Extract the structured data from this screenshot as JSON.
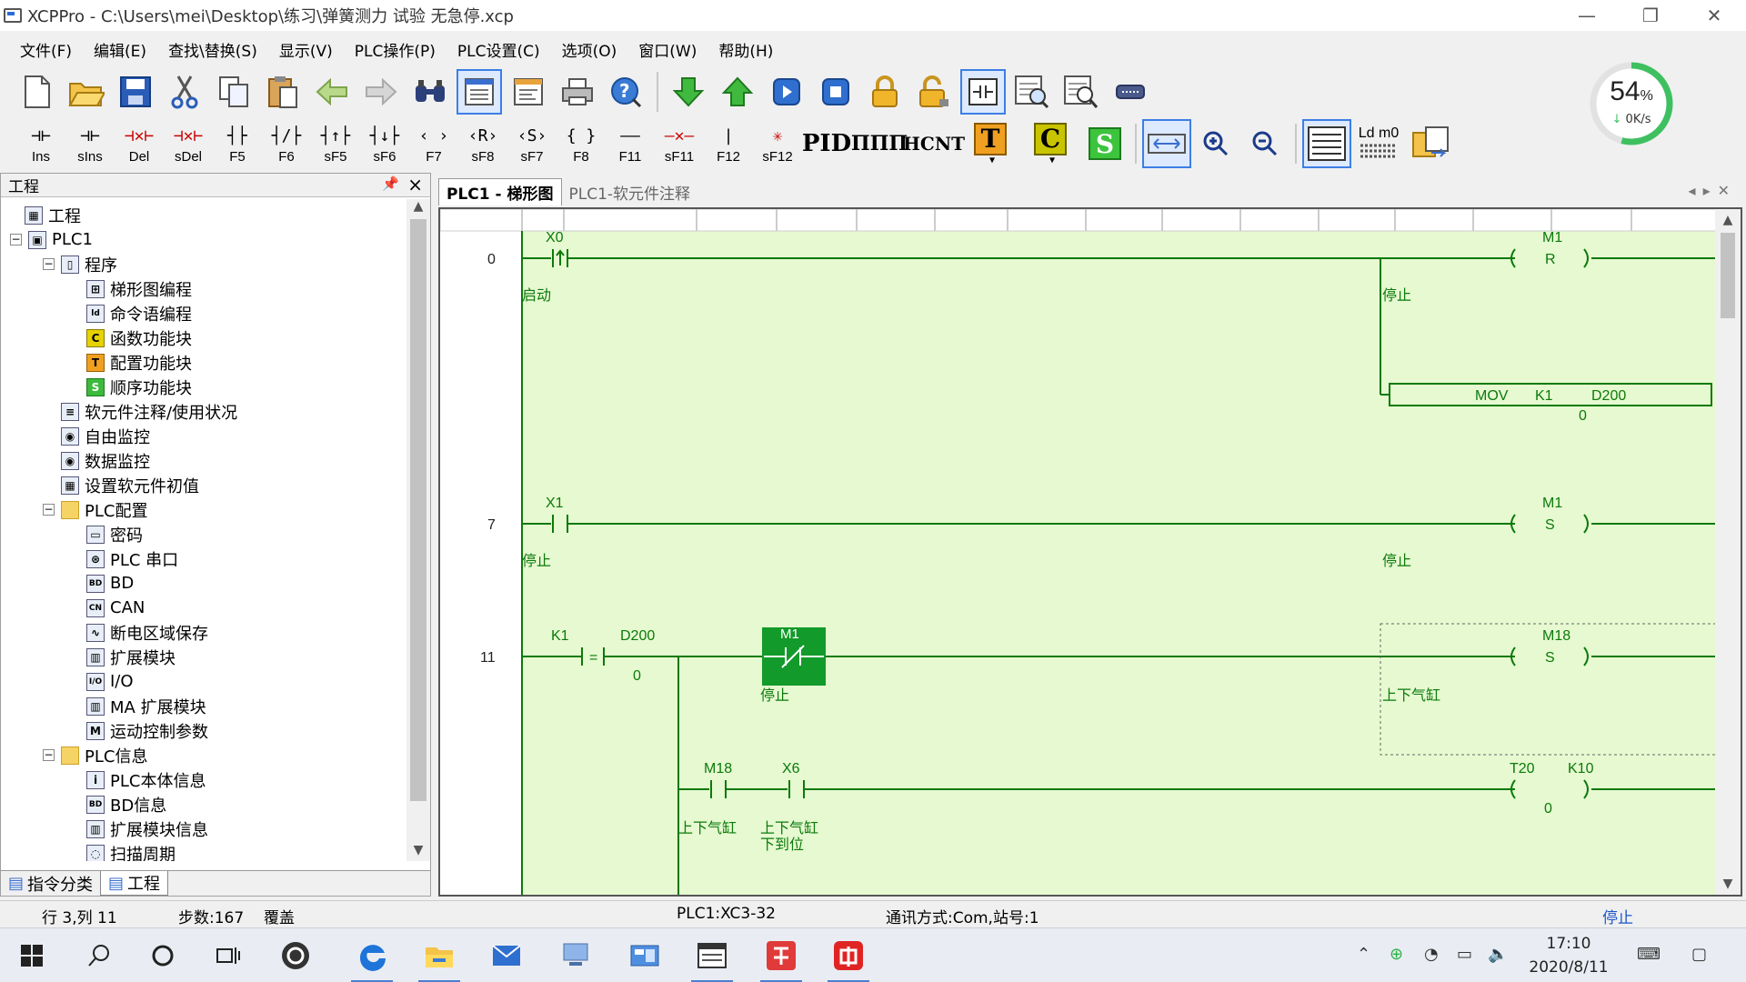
{
  "window": {
    "title": "XCPPro - C:\\Users\\mei\\Desktop\\练习\\弹簧测力 试验 无急停.xcp",
    "controls": [
      "minimize",
      "restore",
      "close"
    ]
  },
  "menu": [
    "文件(F)",
    "编辑(E)",
    "查找\\替换(S)",
    "显示(V)",
    "PLC操作(P)",
    "PLC设置(C)",
    "选项(O)",
    "窗口(W)",
    "帮助(H)"
  ],
  "toolbar_main": [
    {
      "name": "new-icon"
    },
    {
      "name": "open-icon"
    },
    {
      "name": "save-icon"
    },
    {
      "name": "cut-icon"
    },
    {
      "name": "copy-icon"
    },
    {
      "name": "paste-icon"
    },
    {
      "name": "back-icon"
    },
    {
      "name": "forward-icon"
    },
    {
      "name": "find-icon"
    },
    {
      "name": "ladder-view-icon",
      "active": true
    },
    {
      "name": "instruction-view-icon"
    },
    {
      "name": "print-icon"
    },
    {
      "name": "help-icon"
    },
    {
      "name": "download-icon"
    },
    {
      "name": "upload-icon"
    },
    {
      "name": "run-icon"
    },
    {
      "name": "stop-icon"
    },
    {
      "name": "lock-icon"
    },
    {
      "name": "unlock-icon"
    },
    {
      "name": "monitor-ladder-icon",
      "active": true
    },
    {
      "name": "free-monitor-icon"
    },
    {
      "name": "data-monitor-icon"
    },
    {
      "name": "comm-icon"
    }
  ],
  "toolbar_ladder": [
    {
      "sym": "⊣⊢",
      "cap": "Ins"
    },
    {
      "sym": "⊣⊢",
      "cap": "sIns"
    },
    {
      "sym": "⊣✕⊢",
      "cap": "Del"
    },
    {
      "sym": "⊣✕⊢",
      "cap": "sDel"
    },
    {
      "sym": "┤├",
      "cap": "F5"
    },
    {
      "sym": "┤/├",
      "cap": "F6"
    },
    {
      "sym": "┤↑├",
      "cap": "sF5"
    },
    {
      "sym": "┤↓├",
      "cap": "sF6"
    },
    {
      "sym": "‹ ›",
      "cap": "F7"
    },
    {
      "sym": "‹R›",
      "cap": "sF8"
    },
    {
      "sym": "‹S›",
      "cap": "sF7"
    },
    {
      "sym": "{ }",
      "cap": "F8"
    },
    {
      "sym": "——",
      "cap": "F11"
    },
    {
      "sym": "—✕—",
      "cap": "sF11"
    },
    {
      "sym": "|",
      "cap": "F12"
    },
    {
      "sym": "✳",
      "cap": "sF12"
    }
  ],
  "toolbar_blocks": [
    "PID",
    "ΠΠΠ",
    "HCNT",
    "T",
    "C",
    "S"
  ],
  "toolbar_misc": {
    "ld_label": "Ld m0"
  },
  "gauge": {
    "percent": 54,
    "percent_text": "54",
    "unit": "%",
    "speed": "0K/s"
  },
  "left_panel": {
    "title": "工程",
    "tree": [
      {
        "label": "工程",
        "depth": 0,
        "icon": "project"
      },
      {
        "label": "PLC1",
        "depth": 1,
        "icon": "plc"
      },
      {
        "label": "程序",
        "depth": 2,
        "icon": "doc"
      },
      {
        "label": "梯形图编程",
        "depth": 3,
        "icon": "ladder"
      },
      {
        "label": "命令语编程",
        "depth": 3,
        "icon": "ld"
      },
      {
        "label": "函数功能块",
        "depth": 3,
        "icon": "c"
      },
      {
        "label": "配置功能块",
        "depth": 3,
        "icon": "t"
      },
      {
        "label": "顺序功能块",
        "depth": 3,
        "icon": "s"
      },
      {
        "label": "软元件注释/使用状况",
        "depth": 2,
        "icon": "list"
      },
      {
        "label": "自由监控",
        "depth": 2,
        "icon": "monitor"
      },
      {
        "label": "数据监控",
        "depth": 2,
        "icon": "monitor"
      },
      {
        "label": "设置软元件初值",
        "depth": 2,
        "icon": "grid"
      },
      {
        "label": "PLC配置",
        "depth": 2,
        "icon": "folder"
      },
      {
        "label": "密码",
        "depth": 3,
        "icon": "key"
      },
      {
        "label": "PLC 串口",
        "depth": 3,
        "icon": "port"
      },
      {
        "label": "BD",
        "depth": 3,
        "icon": "bd"
      },
      {
        "label": "CAN",
        "depth": 3,
        "icon": "can"
      },
      {
        "label": "断电区域保存",
        "depth": 3,
        "icon": "wave"
      },
      {
        "label": "扩展模块",
        "depth": 3,
        "icon": "ext"
      },
      {
        "label": "I/O",
        "depth": 3,
        "icon": "io"
      },
      {
        "label": "MA 扩展模块",
        "depth": 3,
        "icon": "ext"
      },
      {
        "label": "运动控制参数",
        "depth": 3,
        "icon": "m"
      },
      {
        "label": "PLC信息",
        "depth": 2,
        "icon": "folder"
      },
      {
        "label": "PLC本体信息",
        "depth": 3,
        "icon": "info"
      },
      {
        "label": "BD信息",
        "depth": 3,
        "icon": "bd"
      },
      {
        "label": "扩展模块信息",
        "depth": 3,
        "icon": "ext"
      },
      {
        "label": "扫描周期",
        "depth": 3,
        "icon": "clock"
      }
    ],
    "bottom_tabs": [
      {
        "label": "指令分类",
        "active": false
      },
      {
        "label": "工程",
        "active": true
      }
    ]
  },
  "editor": {
    "tabs": [
      {
        "label": "PLC1 - 梯形图",
        "active": true
      },
      {
        "label": "PLC1-软元件注释",
        "active": false
      }
    ],
    "rungs": [
      {
        "step": "0",
        "contacts": [
          {
            "addr": "X0",
            "type": "rising",
            "comment": "启动"
          }
        ],
        "coils": [
          {
            "addr": "M1",
            "op": "R",
            "comment": "停止"
          }
        ],
        "instruction": {
          "mnemonic": "MOV",
          "src": "K1",
          "dst": "D200",
          "value": "0"
        }
      },
      {
        "step": "7",
        "contacts": [
          {
            "addr": "X1",
            "type": "no",
            "comment": "停止"
          }
        ],
        "coils": [
          {
            "addr": "M1",
            "op": "S",
            "comment": "停止"
          }
        ]
      },
      {
        "step": "11",
        "compare": {
          "left": "K1",
          "op": "=",
          "right": "D200",
          "value": "0"
        },
        "contacts": [
          {
            "addr": "M1",
            "type": "nc",
            "comment": "停止",
            "energized": true
          }
        ],
        "coils": [
          {
            "addr": "M18",
            "op": "S",
            "comment": "上下气缸"
          }
        ],
        "branch": {
          "contacts": [
            {
              "addr": "M18",
              "type": "no",
              "comment": "上下气缸"
            },
            {
              "addr": "X6",
              "type": "no",
              "comment": "上下气缸",
              "comment2": "下到位"
            }
          ],
          "timer": {
            "addr": "T20",
            "preset": "K10",
            "value": "0"
          }
        }
      }
    ]
  },
  "status_bar": {
    "position": "行 3,列 11",
    "steps": "步数:167",
    "mode": "覆盖",
    "plc_model": "PLC1:XC3-32",
    "comm": "通讯方式:Com,站号:1",
    "plc_state": "停止"
  },
  "taskbar": {
    "icons": [
      "windows-start-icon",
      "search-icon",
      "cortana-icon",
      "task-view-icon",
      "app-icon",
      "edge-icon",
      "file-explorer-icon",
      "mail-icon",
      "network-app-icon",
      "control-panel-icon",
      "xcppro-icon",
      "wps-icon",
      "app-red-icon"
    ],
    "time": "17:10",
    "date": "2020/8/11"
  },
  "colors": {
    "ladder_bg": "#e6f9d0",
    "ladder_line": "#0b7a0b",
    "energized": "#129a2a",
    "status_stop": "#1a56c8"
  }
}
